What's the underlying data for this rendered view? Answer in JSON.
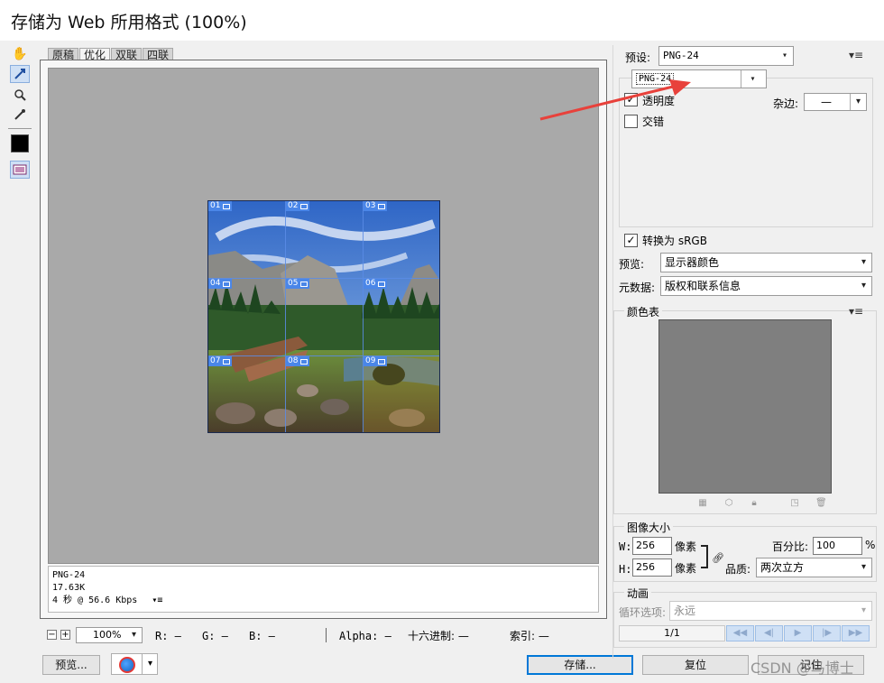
{
  "window": {
    "title": "存储为 Web 所用格式 (100%)"
  },
  "tabs": [
    "原稿",
    "优化",
    "双联",
    "四联"
  ],
  "slices": [
    "01",
    "02",
    "03",
    "04",
    "05",
    "06",
    "07",
    "08",
    "09"
  ],
  "info": {
    "format": "PNG-24",
    "size": "17.63K",
    "speed": "4 秒 @ 56.6 Kbps"
  },
  "status": {
    "zoom": "100%",
    "r": "R: —",
    "g": "G: —",
    "b": "B: —",
    "alpha": "Alpha: —",
    "hex": "十六进制: —",
    "index": "索引: —"
  },
  "bottom": {
    "preview": "预览...",
    "save": "存储...",
    "reset": "复位",
    "done": "记住",
    "watermark": "CSDN @马博士"
  },
  "settings": {
    "preset_label": "预设:",
    "preset_value": "PNG-24",
    "format_value": "PNG-24",
    "transparency": "透明度",
    "transparency_checked": true,
    "interlaced": "交错",
    "interlaced_checked": false,
    "matte_label": "杂边:",
    "matte_value": "—",
    "convert_srgb": "转换为 sRGB",
    "convert_srgb_checked": true,
    "preview_label": "预览:",
    "preview_value": "显示器颜色",
    "metadata_label": "元数据:",
    "metadata_value": "版权和联系信息"
  },
  "color_table": {
    "title": "颜色表"
  },
  "image_size": {
    "title": "图像大小",
    "w_label": "W:",
    "w_value": "256",
    "w_unit": "像素",
    "h_label": "H:",
    "h_value": "256",
    "h_unit": "像素",
    "percent_label": "百分比:",
    "percent_value": "100",
    "percent_unit": "%",
    "quality_label": "品质:",
    "quality_value": "两次立方"
  },
  "animation": {
    "title": "动画",
    "loop_label": "循环选项:",
    "loop_value": "永远",
    "frame": "1/1"
  },
  "colors": {
    "accent": "#4a86e8",
    "arrow": "#e8413b",
    "viewport_bg": "#a9a9a9",
    "color_table_bg": "#7f7f7f"
  }
}
